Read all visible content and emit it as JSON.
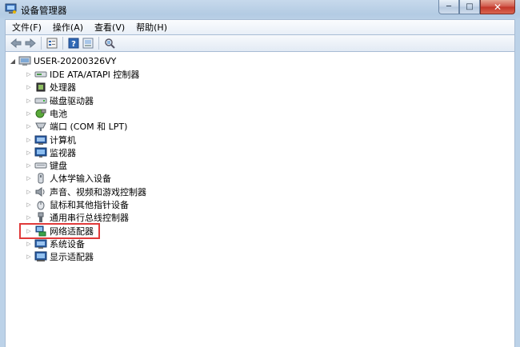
{
  "window": {
    "title": "设备管理器",
    "caption": {
      "minimize": "─",
      "maximize": "□",
      "close": "✕"
    }
  },
  "menu": [
    {
      "label": "文件(F)"
    },
    {
      "label": "操作(A)"
    },
    {
      "label": "查看(V)"
    },
    {
      "label": "帮助(H)"
    }
  ],
  "toolbar": {
    "buttons": [
      {
        "name": "back-icon"
      },
      {
        "name": "forward-icon"
      },
      {
        "name": "properties-icon"
      },
      {
        "name": "help-icon"
      },
      {
        "name": "scan-hardware-icon"
      },
      {
        "name": "hardware-change-icon"
      }
    ]
  },
  "tree": {
    "root": {
      "label": "USER-20200326VY",
      "icon": "computer-icon"
    },
    "items": [
      {
        "label": "IDE ATA/ATAPI 控制器",
        "icon": "ide-controller-icon"
      },
      {
        "label": "处理器",
        "icon": "processor-icon"
      },
      {
        "label": "磁盘驱动器",
        "icon": "disk-drive-icon"
      },
      {
        "label": "电池",
        "icon": "battery-icon"
      },
      {
        "label": "端口 (COM 和 LPT)",
        "icon": "port-icon"
      },
      {
        "label": "计算机",
        "icon": "computer-icon"
      },
      {
        "label": "监视器",
        "icon": "monitor-icon"
      },
      {
        "label": "键盘",
        "icon": "keyboard-icon"
      },
      {
        "label": "人体学输入设备",
        "icon": "hid-icon"
      },
      {
        "label": "声音、视频和游戏控制器",
        "icon": "sound-icon"
      },
      {
        "label": "鼠标和其他指针设备",
        "icon": "mouse-icon"
      },
      {
        "label": "通用串行总线控制器",
        "icon": "usb-icon"
      },
      {
        "label": "网络适配器",
        "icon": "network-adapter-icon",
        "highlighted": true
      },
      {
        "label": "系统设备",
        "icon": "system-device-icon"
      },
      {
        "label": "显示适配器",
        "icon": "display-adapter-icon"
      }
    ]
  },
  "colors": {
    "highlight_border": "#e03a3a",
    "titlebar": "#b9cfe6"
  }
}
